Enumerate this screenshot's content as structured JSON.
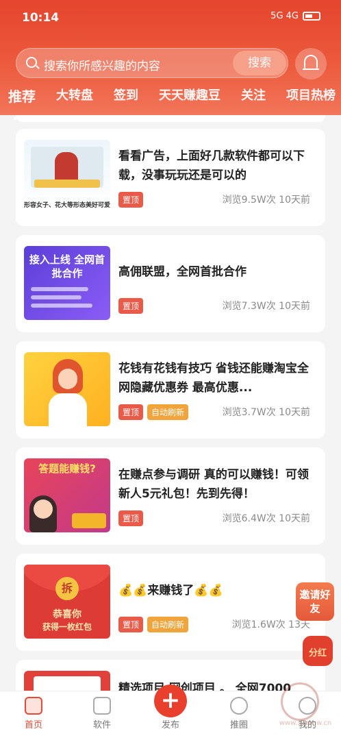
{
  "status_bar": {
    "time": "10:14",
    "signal_text": "5G 4G"
  },
  "search": {
    "placeholder": "搜索你所感兴趣的内容",
    "button_label": "搜索"
  },
  "tabs": [
    {
      "label": "推荐",
      "active": true
    },
    {
      "label": "大转盘"
    },
    {
      "label": "签到"
    },
    {
      "label": "天天赚趣豆"
    },
    {
      "label": "关注"
    },
    {
      "label": "项目热榜"
    }
  ],
  "cards": [
    {
      "title": "看看广告，上面好几款软件都可以下载，没事玩玩还是可以的",
      "pin_label": "置顶",
      "meta": "浏览9.5W次 10天前",
      "thumb_caption": "形容女子、花大等形态美好可爱"
    },
    {
      "title": "高佣联盟，全网首批合作",
      "pin_label": "置顶",
      "meta": "浏览7.3W次 10天前",
      "thumb_headline": "接入上线 全网首批合作"
    },
    {
      "title": "花钱有花钱有技巧 省钱还能赚淘宝全网隐藏优惠券 最高优惠...",
      "pin_label": "置顶",
      "refresh_label": "自动刷新",
      "meta": "浏览3.7W次 10天前"
    },
    {
      "title": "在赚点参与调研 真的可以赚钱！可领新人5元礼包！先到先得！",
      "pin_label": "置顶",
      "meta": "浏览6.4W次 10天前",
      "thumb_headline": "答题能赚钱?"
    },
    {
      "title": "💰💰来赚钱了💰💰",
      "pin_label": "置顶",
      "refresh_label": "自动刷新",
      "meta": "浏览1.6W次 13天",
      "thumb_coin": "拆",
      "thumb_line1": "恭喜你",
      "thumb_line2": "获得一枚红包"
    },
    {
      "title": "精选项目 网创项目 。 全网7000"
    }
  ],
  "floats": {
    "invite_label": "邀请好友",
    "bonus_label": "分红"
  },
  "bottom_nav": [
    {
      "label": "首页",
      "active": true
    },
    {
      "label": "软件"
    },
    {
      "label": "发布"
    },
    {
      "label": "推圈"
    },
    {
      "label": "我的"
    }
  ],
  "watermark": "www.5asmw.cn",
  "colors": {
    "accent": "#e8402c",
    "pin_tag": "#ea5a48",
    "refresh_tag": "#f0a43a"
  }
}
